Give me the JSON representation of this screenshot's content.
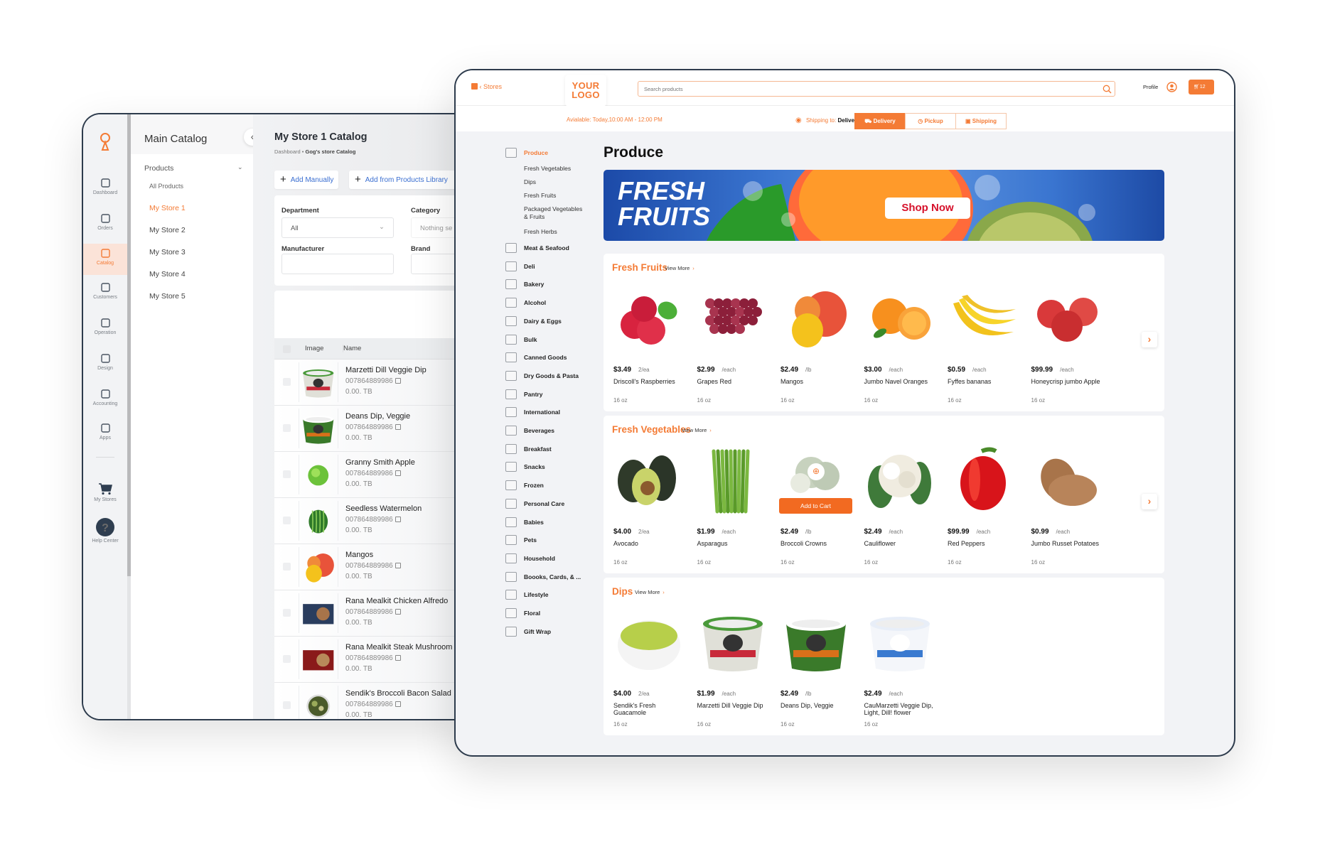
{
  "admin": {
    "rail": [
      {
        "label": "Dashboard",
        "icon": "home-icon"
      },
      {
        "label": "Orders",
        "icon": "bag-icon"
      },
      {
        "label": "Catalog",
        "icon": "clipboard-icon",
        "active": true
      },
      {
        "label": "Customers",
        "icon": "users-icon"
      },
      {
        "label": "Operation",
        "icon": "operation-icon"
      },
      {
        "label": "Design",
        "icon": "drops-icon"
      },
      {
        "label": "Accounting",
        "icon": "calculator-icon"
      },
      {
        "label": "Apps",
        "icon": "grid-icon"
      },
      {
        "label": "My Stores",
        "icon": "cart-icon"
      },
      {
        "label": "Help Center",
        "icon": "help-icon"
      }
    ],
    "panel": {
      "title": "Main Catalog",
      "section": "Products",
      "all_products": "All Products",
      "stores": [
        "My Store 1",
        "My Store 2",
        "My Store 3",
        "My Store 4",
        "My Store 5"
      ],
      "active_store": "My Store 1"
    },
    "content": {
      "title": "My Store 1 Catalog",
      "breadcrumb": [
        "Dashboard",
        "Gog's store Catalog"
      ],
      "add_manually": "Add Manually",
      "add_library": "Add from Products Library",
      "filters": {
        "department_label": "Department",
        "department_value": "All",
        "category_label": "Category",
        "category_placeholder": "Nothing se",
        "manufacturer_label": "Manufacturer",
        "manufacturer_value": "",
        "brand_label": "Brand"
      },
      "table_headers": [
        "Image",
        "Name"
      ],
      "rows": [
        {
          "name": "Marzetti Dill Veggie Dip",
          "sku": "007864889986",
          "price": "0.00. TB",
          "image": "tub-marzetti"
        },
        {
          "name": "Deans Dip, Veggie",
          "sku": "007864889986",
          "price": "0.00. TB",
          "image": "tub-deans"
        },
        {
          "name": "Granny Smith Apple",
          "sku": "007864889986",
          "price": "0.00. TB",
          "image": "green-apple"
        },
        {
          "name": "Seedless Watermelon",
          "sku": "007864889986",
          "price": "0.00. TB",
          "image": "watermelon"
        },
        {
          "name": "Mangos",
          "sku": "007864889986",
          "price": "0.00. TB",
          "image": "mango"
        },
        {
          "name": "Rana Mealkit Chicken Alfredo",
          "sku": "007864889986",
          "price": "0.00. TB",
          "image": "mealkit-blue"
        },
        {
          "name": "Rana Mealkit Steak Mushroom",
          "sku": "007864889986",
          "price": "0.00. TB",
          "image": "mealkit-red"
        },
        {
          "name": "Sendik's Broccoli Bacon Salad",
          "sku": "007864889986",
          "price": "0.00. TB",
          "image": "salad"
        }
      ]
    }
  },
  "store": {
    "back_label": "Stores",
    "logo": [
      "YOUR",
      "LOGO"
    ],
    "search_placeholder": "Search products",
    "profile_label": "Profile",
    "cart_count": "12",
    "available": "Avialable: Today,10:00 AM - 12:00 PM",
    "shipping_to_label": "Shipping to:",
    "shipping_address": "Delivery Address",
    "modes": [
      {
        "label": "Delivery",
        "active": true
      },
      {
        "label": "Pickup"
      },
      {
        "label": "Shipping"
      }
    ],
    "accent": "#f47b35",
    "categories": [
      {
        "label": "Produce",
        "active": true,
        "sub": [
          "Fresh Vegetables",
          "Dips",
          "Fresh Fruits",
          "Packaged Vegetables & Fruits",
          "Fresh Herbs"
        ]
      },
      {
        "label": "Meat & Seafood"
      },
      {
        "label": "Deli"
      },
      {
        "label": "Bakery"
      },
      {
        "label": "Alcohol"
      },
      {
        "label": "Dairy & Eggs"
      },
      {
        "label": "Bulk"
      },
      {
        "label": "Canned Goods"
      },
      {
        "label": "Dry Goods & Pasta"
      },
      {
        "label": "Pantry"
      },
      {
        "label": "International"
      },
      {
        "label": "Beverages"
      },
      {
        "label": "Breakfast"
      },
      {
        "label": "Snacks"
      },
      {
        "label": "Frozen"
      },
      {
        "label": "Personal Care"
      },
      {
        "label": "Babies"
      },
      {
        "label": "Pets"
      },
      {
        "label": "Household"
      },
      {
        "label": "Boooks, Cards, & ..."
      },
      {
        "label": "Lifestyle"
      },
      {
        "label": "Floral"
      },
      {
        "label": "Gift Wrap"
      }
    ],
    "page_title": "Produce",
    "banner": {
      "line1": "FRESH",
      "line2": "FRUITS",
      "cta": "Shop Now"
    },
    "view_more": "View More",
    "sections": [
      {
        "title": "Fresh Fruits",
        "products": [
          {
            "price": "$3.49",
            "unit": "2/ea",
            "name": "Driscoll's Raspberries",
            "size": "16 oz",
            "image": "raspberries"
          },
          {
            "price": "$2.99",
            "unit": "/each",
            "name": "Grapes Red",
            "size": "16 oz",
            "image": "grapes"
          },
          {
            "price": "$2.49",
            "unit": "/lb",
            "name": "Mangos",
            "size": "16 oz",
            "image": "mango"
          },
          {
            "price": "$3.00",
            "unit": "/each",
            "name": "Jumbo Navel Oranges",
            "size": "16 oz",
            "image": "orange"
          },
          {
            "price": "$0.59",
            "unit": "/each",
            "name": "Fyffes bananas",
            "size": "16 oz",
            "image": "banana"
          },
          {
            "price": "$99.99",
            "unit": "/each",
            "name": "Honeycrisp jumbo Apple",
            "size": "16 oz",
            "image": "apple"
          }
        ]
      },
      {
        "title": "Fresh Vegetables",
        "products": [
          {
            "price": "$4.00",
            "unit": "2/ea",
            "name": "Avocado",
            "size": "16 oz",
            "image": "avocado"
          },
          {
            "price": "$1.99",
            "unit": "/each",
            "name": "Asparagus",
            "size": "16 oz",
            "image": "asparagus"
          },
          {
            "price": "$2.49",
            "unit": "/lb",
            "name": "Broccoli Crowns",
            "size": "16 oz",
            "image": "broccoli",
            "hover": true,
            "add_to_cart": "Add to Cart"
          },
          {
            "price": "$2.49",
            "unit": "/each",
            "name": "Cauliflower",
            "size": "16 oz",
            "image": "cauliflower"
          },
          {
            "price": "$99.99",
            "unit": "/each",
            "name": "Red Peppers",
            "size": "16 oz",
            "image": "pepper"
          },
          {
            "price": "$0.99",
            "unit": "/each",
            "name": "Jumbo Russet Potatoes",
            "size": "16 oz",
            "image": "potato"
          }
        ]
      },
      {
        "title": "Dips",
        "products": [
          {
            "price": "$4.00",
            "unit": "2/ea",
            "name": "Sendik's Fresh Guacamole",
            "size": "16 oz",
            "image": "guacamole"
          },
          {
            "price": "$1.99",
            "unit": "/each",
            "name": "Marzetti Dill Veggie Dip",
            "size": "16 oz",
            "image": "tub-marzetti"
          },
          {
            "price": "$2.49",
            "unit": "/lb",
            "name": "Deans Dip, Veggie",
            "size": "16 oz",
            "image": "tub-deans"
          },
          {
            "price": "$2.49",
            "unit": "/each",
            "name": "CauMarzetti Veggie Dip, Light, Dill! flower",
            "size": "16 oz",
            "image": "tub-dill"
          }
        ]
      }
    ]
  }
}
